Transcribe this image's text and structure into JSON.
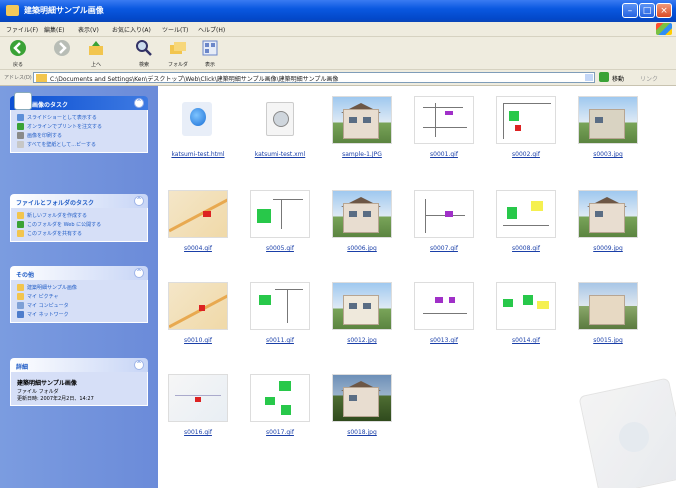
{
  "window": {
    "title": "建築明細サンプル画像"
  },
  "menu": [
    "ファイル(F)",
    "編集(E)",
    "表示(V)",
    "お気に入り(A)",
    "ツール(T)",
    "ヘルプ(H)"
  ],
  "toolbar": {
    "back": "戻る",
    "forward": "",
    "up": "上へ",
    "search": "検索",
    "folders": "フォルダ",
    "views": "表示"
  },
  "address": {
    "label": "アドレス(D)",
    "path": "C:\\Documents and Settings\\Ken\\デスクトップ\\Web\\Click\\建築明細サンプル画像\\建築明細サンプル画像",
    "go_label": "移動",
    "links_label": "リンク"
  },
  "sidebar": {
    "image_tasks": {
      "title": "画像のタスク",
      "items": [
        "スライドショーとして表示する",
        "オンラインでプリントを注文する",
        "画像を印刷する",
        "すべてを壁紙として...ピーする"
      ]
    },
    "file_tasks": {
      "title": "ファイルとフォルダのタスク",
      "items": [
        "新しいフォルダを作成する",
        "このフォルダを Web に公開する",
        "このフォルダを共有する"
      ]
    },
    "other_places": {
      "title": "その他",
      "items": [
        "建築明細サンプル画像",
        "マイ ピクチャ",
        "マイ コンピュータ",
        "マイ ネットワーク"
      ]
    },
    "details": {
      "title": "詳細",
      "name": "建築明細サンプル画像",
      "type": "ファイル フォルダ",
      "modified": "更新日時: 2007年2月2日、14:27"
    }
  },
  "files": [
    {
      "name": "katsumi-test.html"
    },
    {
      "name": "katsumi-test.xml"
    },
    {
      "name": "sample-1.JPG"
    },
    {
      "name": "s0001.gif"
    },
    {
      "name": "s0002.gif"
    },
    {
      "name": "s0003.jpg"
    },
    {
      "name": "s0004.gif"
    },
    {
      "name": "s0005.gif"
    },
    {
      "name": "s0006.jpg"
    },
    {
      "name": "s0007.gif"
    },
    {
      "name": "s0008.gif"
    },
    {
      "name": "s0009.jpg"
    },
    {
      "name": "s0010.gif"
    },
    {
      "name": "s0011.gif"
    },
    {
      "name": "s0012.jpg"
    },
    {
      "name": "s0013.gif"
    },
    {
      "name": "s0014.gif"
    },
    {
      "name": "s0015.jpg"
    },
    {
      "name": "s0016.gif"
    },
    {
      "name": "s0017.gif"
    },
    {
      "name": "s0018.jpg"
    }
  ]
}
